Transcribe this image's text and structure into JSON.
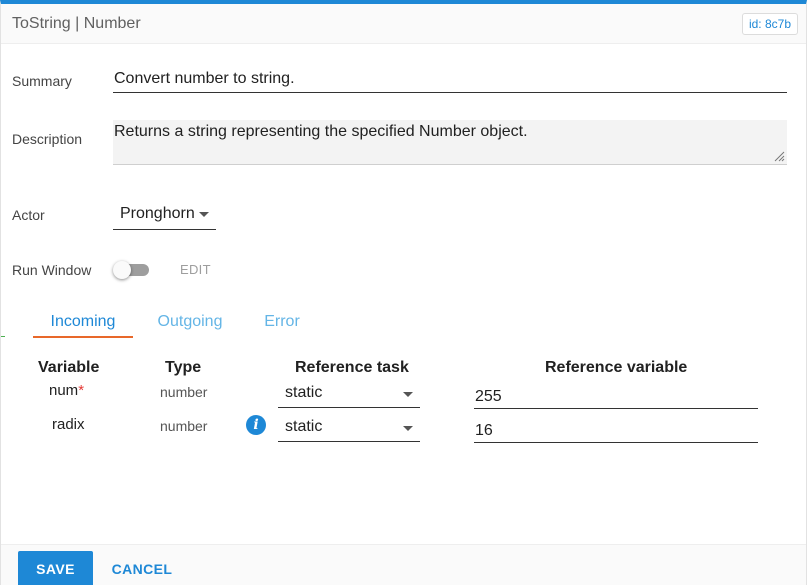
{
  "header": {
    "title": "ToString | Number",
    "id_badge": "id: 8c7b"
  },
  "form": {
    "summary": {
      "label": "Summary",
      "value": "Convert number to string."
    },
    "description": {
      "label": "Description",
      "value": "Returns a string representing the specified Number object."
    },
    "actor": {
      "label": "Actor",
      "value": "Pronghorn"
    },
    "run_window": {
      "label": "Run Window",
      "enabled": false,
      "edit_label": "EDIT"
    }
  },
  "tabs": [
    {
      "label": "Incoming",
      "active": true
    },
    {
      "label": "Outgoing",
      "active": false
    },
    {
      "label": "Error",
      "active": false
    }
  ],
  "table": {
    "headers": {
      "variable": "Variable",
      "type": "Type",
      "reference_task": "Reference task",
      "reference_variable": "Reference variable"
    },
    "rows": [
      {
        "variable": "num",
        "required_marker": "*",
        "type": "number",
        "reference_task": "static",
        "reference_variable": "255",
        "info_icon": false
      },
      {
        "variable": "radix",
        "required_marker": "",
        "type": "number",
        "reference_task": "static",
        "reference_variable": "16",
        "info_icon": true
      }
    ]
  },
  "footer": {
    "save_label": "SAVE",
    "cancel_label": "CANCEL"
  },
  "colors": {
    "accent": "#1e88d6",
    "tab_indicator": "#e8682a",
    "required": "#e53935"
  },
  "icons": {
    "info": "info-icon",
    "dropdown": "chevron-down-icon",
    "resize": "resize-grip-icon"
  }
}
